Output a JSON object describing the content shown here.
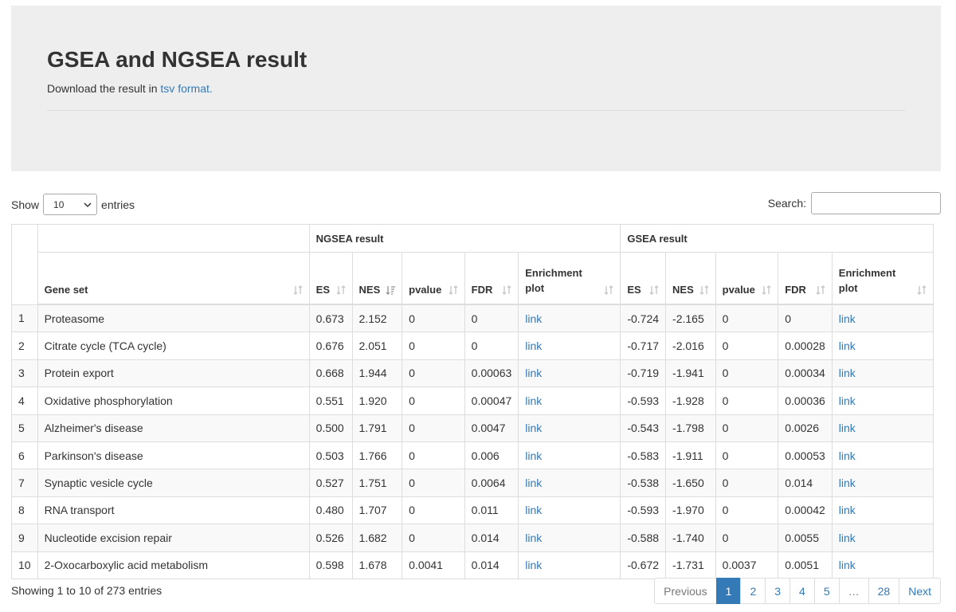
{
  "header": {
    "title": "GSEA and NGSEA result",
    "download_prefix": "Download the result in ",
    "download_link": "tsv format."
  },
  "controls": {
    "show_label": "Show",
    "entries_value": "10",
    "entries_label": "entries",
    "search_label": "Search:",
    "search_value": ""
  },
  "table": {
    "group_headers": [
      "NGSEA result",
      "GSEA result"
    ],
    "columns": [
      "Gene set",
      "ES",
      "NES",
      "pvalue",
      "FDR",
      "Enrichment plot",
      "ES",
      "NES",
      "pvalue",
      "FDR",
      "Enrichment plot"
    ],
    "rows": [
      [
        "1",
        "Proteasome",
        "0.673",
        "2.152",
        "0",
        "0",
        "link",
        "-0.724",
        "-2.165",
        "0",
        "0",
        "link"
      ],
      [
        "2",
        "Citrate cycle (TCA cycle)",
        "0.676",
        "2.051",
        "0",
        "0",
        "link",
        "-0.717",
        "-2.016",
        "0",
        "0.00028",
        "link"
      ],
      [
        "3",
        "Protein export",
        "0.668",
        "1.944",
        "0",
        "0.00063",
        "link",
        "-0.719",
        "-1.941",
        "0",
        "0.00034",
        "link"
      ],
      [
        "4",
        "Oxidative phosphorylation",
        "0.551",
        "1.920",
        "0",
        "0.00047",
        "link",
        "-0.593",
        "-1.928",
        "0",
        "0.00036",
        "link"
      ],
      [
        "5",
        "Alzheimer's disease",
        "0.500",
        "1.791",
        "0",
        "0.0047",
        "link",
        "-0.543",
        "-1.798",
        "0",
        "0.0026",
        "link"
      ],
      [
        "6",
        "Parkinson's disease",
        "0.503",
        "1.766",
        "0",
        "0.006",
        "link",
        "-0.583",
        "-1.911",
        "0",
        "0.00053",
        "link"
      ],
      [
        "7",
        "Synaptic vesicle cycle",
        "0.527",
        "1.751",
        "0",
        "0.0064",
        "link",
        "-0.538",
        "-1.650",
        "0",
        "0.014",
        "link"
      ],
      [
        "8",
        "RNA transport",
        "0.480",
        "1.707",
        "0",
        "0.011",
        "link",
        "-0.593",
        "-1.970",
        "0",
        "0.00042",
        "link"
      ],
      [
        "9",
        "Nucleotide excision repair",
        "0.526",
        "1.682",
        "0",
        "0.014",
        "link",
        "-0.588",
        "-1.740",
        "0",
        "0.0055",
        "link"
      ],
      [
        "10",
        "2-Oxocarboxylic acid metabolism",
        "0.598",
        "1.678",
        "0.0041",
        "0.014",
        "link",
        "-0.672",
        "-1.731",
        "0.0037",
        "0.0051",
        "link"
      ]
    ]
  },
  "footer": {
    "info": "Showing 1 to 10 of 273 entries",
    "pagination": [
      "Previous",
      "1",
      "2",
      "3",
      "4",
      "5",
      "…",
      "28",
      "Next"
    ],
    "active_page": "1"
  },
  "colors": {
    "link": "#337ab7",
    "header_bg": "#eeeeee",
    "stripe": "#f9f9f9",
    "sort_icon": "#c8c8c8"
  }
}
